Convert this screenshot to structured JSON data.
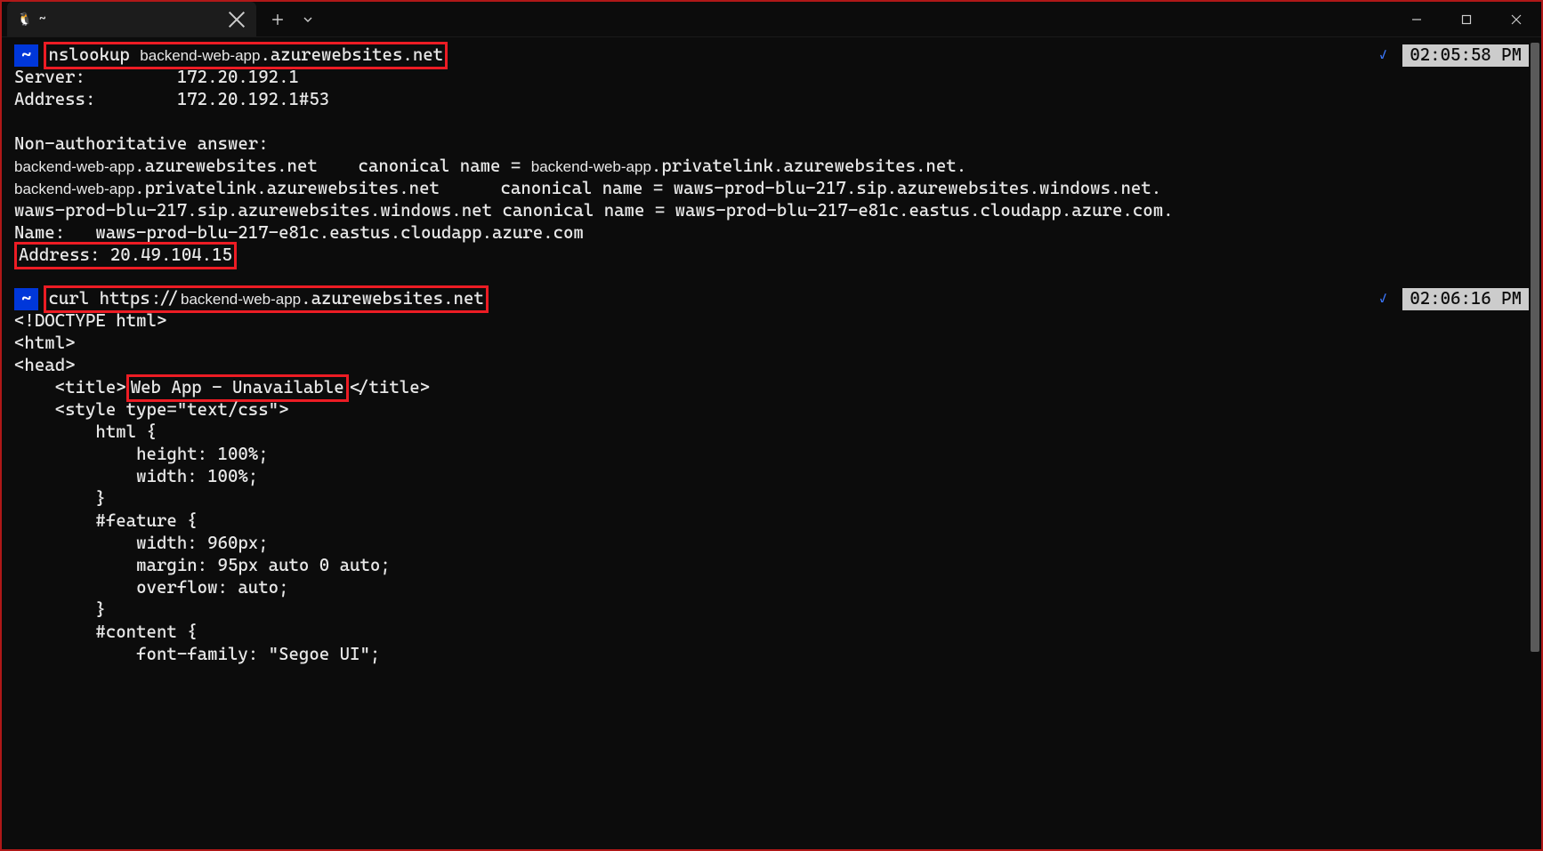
{
  "tab": {
    "icon": "🐧",
    "title": "~"
  },
  "cmd1": {
    "prompt": "~",
    "command_prefix": "nslookup ",
    "hostname_placeholder": "backend-web-app",
    "command_suffix": ".azurewebsites.net",
    "time": "02:05:58 PM"
  },
  "out1": {
    "server_label": "Server:",
    "server_value": "172.20.192.1",
    "address_label": "Address:",
    "address_value": "172.20.192.1#53",
    "nonauth": "Non-authoritative answer:",
    "line1_suffix": ".azurewebsites.net    canonical name = ",
    "line1_end": ".privatelink.azurewebsites.net.",
    "line2_suffix": ".privatelink.azurewebsites.net      canonical name = waws-prod-blu-217.sip.azurewebsites.windows.net.",
    "line3": "waws-prod-blu-217.sip.azurewebsites.windows.net canonical name = waws-prod-blu-217-e81c.eastus.cloudapp.azure.com.",
    "line4": "Name:   waws-prod-blu-217-e81c.eastus.cloudapp.azure.com",
    "resolved": "Address: 20.49.104.15"
  },
  "cmd2": {
    "prompt": "~",
    "command_prefix": "curl https://",
    "hostname_placeholder": "backend-web-app",
    "command_suffix": ".azurewebsites.net",
    "time": "02:06:16 PM"
  },
  "out2": {
    "l1": "<!DOCTYPE html>",
    "l2": "<html>",
    "l3": "<head>",
    "l4a": "    <title>",
    "l4_title": "Web App - Unavailable",
    "l4b": "</title>",
    "l5": "    <style type=\"text/css\">",
    "l6": "        html {",
    "l7": "            height: 100%;",
    "l8": "            width: 100%;",
    "l9": "        }",
    "l10": "",
    "l11": "        #feature {",
    "l12": "            width: 960px;",
    "l13": "            margin: 95px auto 0 auto;",
    "l14": "            overflow: auto;",
    "l15": "        }",
    "l16": "",
    "l17": "        #content {",
    "l18": "            font-family: \"Segoe UI\";"
  }
}
